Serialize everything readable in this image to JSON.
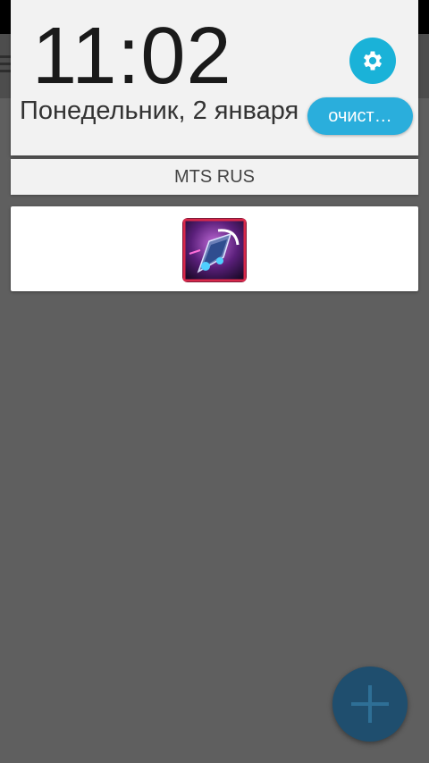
{
  "lock_shade": {
    "time": "11:02",
    "date": "Понедельник, 2 января",
    "clear_label": "очист…",
    "settings_icon": "gear-icon"
  },
  "carrier": {
    "name": "MTS RUS"
  },
  "notification": {
    "app_icon": "game-spaceship-icon"
  },
  "fab": {
    "icon": "plus-icon"
  },
  "colors": {
    "accent": "#1ab2d8",
    "fab": "#1f4e6e",
    "panel": "#f2f2f2",
    "background": "#5f5f5f"
  }
}
